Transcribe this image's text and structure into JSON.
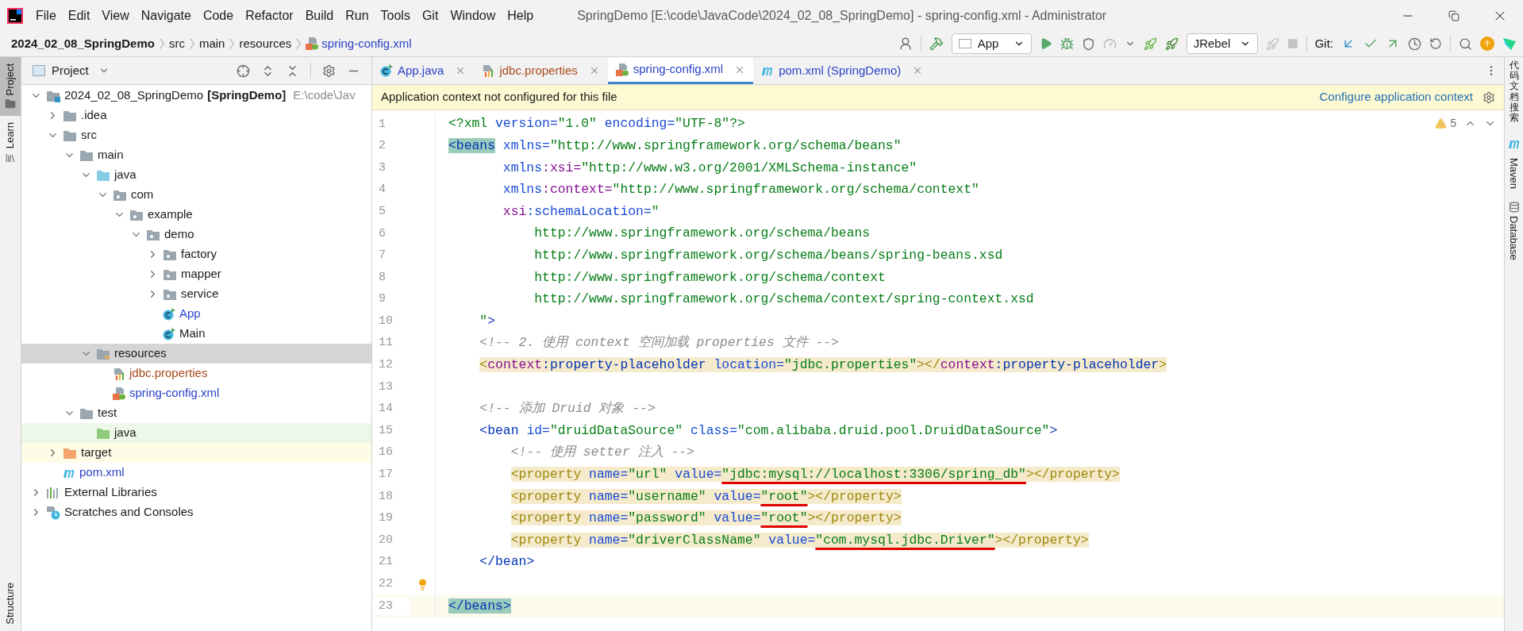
{
  "menu": [
    "File",
    "Edit",
    "View",
    "Navigate",
    "Code",
    "Refactor",
    "Build",
    "Run",
    "Tools",
    "Git",
    "Window",
    "Help"
  ],
  "window": {
    "title": "SpringDemo [E:\\code\\JavaCode\\2024_02_08_SpringDemo] - spring-config.xml - Administrator"
  },
  "breadcrumb": [
    {
      "label": "2024_02_08_SpringDemo",
      "kind": "project"
    },
    {
      "label": "src",
      "kind": "folder"
    },
    {
      "label": "main",
      "kind": "folder"
    },
    {
      "label": "resources",
      "kind": "folder"
    },
    {
      "label": "spring-config.xml",
      "kind": "file"
    }
  ],
  "toolbar": {
    "run_config": "App",
    "jrebel": "JRebel",
    "git_label": "Git:"
  },
  "left_strip": [
    {
      "label": "Project",
      "selected": true
    },
    {
      "label": "Learn",
      "selected": false
    }
  ],
  "left_strip_bottom": [
    {
      "label": "Structure",
      "selected": false
    }
  ],
  "right_strip": [
    {
      "label": "代码文档搜索",
      "kind": "cjk"
    },
    {
      "label": "Maven",
      "kind": "maven"
    },
    {
      "label": "Database",
      "kind": "database"
    }
  ],
  "project_panel": {
    "title": "Project",
    "tree": [
      {
        "label": "2024_02_08_SpringDemo",
        "module": "[SpringDemo]",
        "path": "E:\\code\\Jav",
        "kind": "module",
        "expanded": true,
        "selected": false,
        "children": [
          {
            "label": ".idea",
            "kind": "folder",
            "expanded": false,
            "selected": false
          },
          {
            "label": "src",
            "kind": "folder",
            "expanded": true,
            "selected": false,
            "children": [
              {
                "label": "main",
                "kind": "folder",
                "expanded": true,
                "selected": false,
                "children": [
                  {
                    "label": "java",
                    "kind": "source",
                    "expanded": true,
                    "selected": false,
                    "children": [
                      {
                        "label": "com",
                        "kind": "package",
                        "expanded": true,
                        "selected": false,
                        "children": [
                          {
                            "label": "example",
                            "kind": "package",
                            "expanded": true,
                            "selected": false,
                            "children": [
                              {
                                "label": "demo",
                                "kind": "package",
                                "expanded": true,
                                "selected": false,
                                "children": [
                                  {
                                    "label": "factory",
                                    "kind": "package",
                                    "expanded": false,
                                    "selected": false
                                  },
                                  {
                                    "label": "mapper",
                                    "kind": "package",
                                    "expanded": false,
                                    "selected": false
                                  },
                                  {
                                    "label": "service",
                                    "kind": "package",
                                    "expanded": false,
                                    "selected": false
                                  },
                                  {
                                    "label": "App",
                                    "kind": "class",
                                    "color": "#2a43c8",
                                    "selected": false
                                  },
                                  {
                                    "label": "Main",
                                    "kind": "class",
                                    "selected": false
                                  }
                                ]
                              }
                            ]
                          }
                        ]
                      }
                    ]
                  },
                  {
                    "label": "resources",
                    "kind": "resources",
                    "expanded": true,
                    "selected": true,
                    "children": [
                      {
                        "label": "jdbc.properties",
                        "kind": "properties",
                        "color": "#a84a1c",
                        "selected": false
                      },
                      {
                        "label": "spring-config.xml",
                        "kind": "spring",
                        "color": "#2a43c8",
                        "selected": false
                      }
                    ]
                  }
                ]
              },
              {
                "label": "test",
                "kind": "folder",
                "expanded": true,
                "selected": false,
                "children": [
                  {
                    "label": "java",
                    "kind": "test",
                    "selected": false
                  }
                ]
              }
            ]
          },
          {
            "label": "target",
            "kind": "excluded",
            "expanded": false,
            "selected": false
          },
          {
            "label": "pom.xml",
            "kind": "maven",
            "color": "#2a43c8",
            "selected": false
          }
        ]
      },
      {
        "label": "External Libraries",
        "kind": "libraries",
        "expanded": false,
        "selected": false
      },
      {
        "label": "Scratches and Consoles",
        "kind": "scratches",
        "expanded": false,
        "selected": false
      }
    ]
  },
  "tabs": [
    {
      "label": "App.java",
      "kind": "class",
      "color": "#2a43c8",
      "selected": false
    },
    {
      "label": "jdbc.properties",
      "kind": "properties",
      "color": "#a84a1c",
      "selected": false
    },
    {
      "label": "spring-config.xml",
      "kind": "spring",
      "color": "#2a43c8",
      "selected": true
    },
    {
      "label": "pom.xml (SpringDemo)",
      "kind": "maven",
      "color": "#2a43c8",
      "selected": false
    }
  ],
  "banner": {
    "text": "Application context not configured for this file",
    "link": "Configure application context"
  },
  "inspections": {
    "warnings": "5"
  },
  "code": [
    {
      "number": "1",
      "tokens": [
        {
          "kind": "prolog",
          "text": "<?xml"
        },
        {
          "kind": "attr",
          "text": " version="
        },
        {
          "kind": "value",
          "text": "\"1.0\""
        },
        {
          "kind": "attr",
          "text": " encoding="
        },
        {
          "kind": "value",
          "text": "\"UTF-8\""
        },
        {
          "kind": "prolog",
          "text": "?>"
        }
      ]
    },
    {
      "number": "2",
      "tokens": [
        {
          "kind": "tag",
          "text": "<beans",
          "matched": true
        },
        {
          "kind": "attr",
          "text": " xmlns="
        },
        {
          "kind": "value",
          "text": "\"http://www.springframework.org/schema/beans\""
        }
      ]
    },
    {
      "number": "3",
      "tokens": [
        {
          "kind": "attr",
          "text": "       xmlns"
        },
        {
          "kind": "ns",
          "text": ":xsi="
        },
        {
          "kind": "value",
          "text": "\"http://www.w3.org/2001/XMLSchema-instance\""
        }
      ]
    },
    {
      "number": "4",
      "tokens": [
        {
          "kind": "attr",
          "text": "       xmlns"
        },
        {
          "kind": "ns",
          "text": ":context="
        },
        {
          "kind": "value",
          "text": "\"http://www.springframework.org/schema/context\""
        }
      ]
    },
    {
      "number": "5",
      "tokens": [
        {
          "kind": "ns",
          "text": "       xsi"
        },
        {
          "kind": "attr",
          "text": ":schemaLocation="
        },
        {
          "kind": "value",
          "text": "\""
        }
      ]
    },
    {
      "number": "6",
      "tokens": [
        {
          "kind": "value",
          "text": "           http://www.springframework.org/schema/beans"
        }
      ]
    },
    {
      "number": "7",
      "tokens": [
        {
          "kind": "value",
          "text": "           http://www.springframework.org/schema/beans/spring-beans.xsd"
        }
      ]
    },
    {
      "number": "8",
      "tokens": [
        {
          "kind": "value",
          "text": "           http://www.springframework.org/schema/context"
        }
      ]
    },
    {
      "number": "9",
      "tokens": [
        {
          "kind": "value",
          "text": "           http://www.springframework.org/schema/context/spring-context.xsd"
        }
      ]
    },
    {
      "number": "10",
      "tokens": [
        {
          "kind": "value",
          "text": "    \""
        },
        {
          "kind": "tag",
          "text": ">"
        }
      ]
    },
    {
      "number": "11",
      "tokens": [
        {
          "kind": "comment",
          "text": "    <!-- 2. 使用 context 空间加载 properties 文件 -->"
        }
      ]
    },
    {
      "number": "12",
      "highlighted": true,
      "tokens": [
        {
          "kind": "warn",
          "text": "    <"
        },
        {
          "kind": "ns",
          "text": "context"
        },
        {
          "kind": "tag",
          "text": ":property-placeholder"
        },
        {
          "kind": "attr",
          "text": " location="
        },
        {
          "kind": "value",
          "text": "\"jdbc.properties\""
        },
        {
          "kind": "warn",
          "text": "></"
        },
        {
          "kind": "ns",
          "text": "context"
        },
        {
          "kind": "tag",
          "text": ":property-placeholder"
        },
        {
          "kind": "warn",
          "text": ">"
        }
      ]
    },
    {
      "number": "13"
    },
    {
      "number": "14",
      "tokens": [
        {
          "kind": "comment",
          "text": "    <!-- 添加 Druid 对象 -->"
        }
      ]
    },
    {
      "number": "15",
      "tokens": [
        {
          "kind": "tag",
          "text": "    <bean"
        },
        {
          "kind": "attr",
          "text": " id="
        },
        {
          "kind": "value",
          "text": "\"druidDataSource\""
        },
        {
          "kind": "attr",
          "text": " class="
        },
        {
          "kind": "value",
          "text": "\"com.alibaba.druid.pool.DruidDataSource\""
        },
        {
          "kind": "tag",
          "text": ">"
        }
      ]
    },
    {
      "number": "16",
      "tokens": [
        {
          "kind": "comment",
          "text": "        <!-- 使用 setter 注入 -->"
        }
      ]
    },
    {
      "number": "17",
      "highlighted": true,
      "tokens": [
        {
          "kind": "warn",
          "text": "        <property"
        },
        {
          "kind": "attr",
          "text": " name="
        },
        {
          "kind": "value",
          "text": "\"url\""
        },
        {
          "kind": "attr",
          "text": " value="
        },
        {
          "kind": "value",
          "text": "\"jdbc:mysql://localhost:3306/spring_db\"",
          "underlined": true
        },
        {
          "kind": "warn",
          "text": "></property>"
        }
      ]
    },
    {
      "number": "18",
      "highlighted": true,
      "tokens": [
        {
          "kind": "warn",
          "text": "        <property"
        },
        {
          "kind": "attr",
          "text": " name="
        },
        {
          "kind": "value",
          "text": "\"username\""
        },
        {
          "kind": "attr",
          "text": " value="
        },
        {
          "kind": "value",
          "text": "\"root\"",
          "underlined": true
        },
        {
          "kind": "warn",
          "text": "></property>"
        }
      ]
    },
    {
      "number": "19",
      "highlighted": true,
      "tokens": [
        {
          "kind": "warn",
          "text": "        <property"
        },
        {
          "kind": "attr",
          "text": " name="
        },
        {
          "kind": "value",
          "text": "\"password\""
        },
        {
          "kind": "attr",
          "text": " value="
        },
        {
          "kind": "value",
          "text": "\"root\"",
          "underlined": true
        },
        {
          "kind": "warn",
          "text": "></property>"
        }
      ]
    },
    {
      "number": "20",
      "highlighted": true,
      "tokens": [
        {
          "kind": "warn",
          "text": "        <property"
        },
        {
          "kind": "attr",
          "text": " name="
        },
        {
          "kind": "value",
          "text": "\"driverClassName\""
        },
        {
          "kind": "attr",
          "text": " value="
        },
        {
          "kind": "value",
          "text": "\"com.mysql.jdbc.Driver\"",
          "underlined": true
        },
        {
          "kind": "warn",
          "text": "></property>"
        }
      ]
    },
    {
      "number": "21",
      "tokens": [
        {
          "kind": "tag",
          "text": "    </bean>"
        }
      ]
    },
    {
      "number": "22",
      "bulb": true
    },
    {
      "number": "23",
      "current": true,
      "tokens": [
        {
          "kind": "tag",
          "text": "</beans>",
          "matched": true
        }
      ]
    }
  ]
}
